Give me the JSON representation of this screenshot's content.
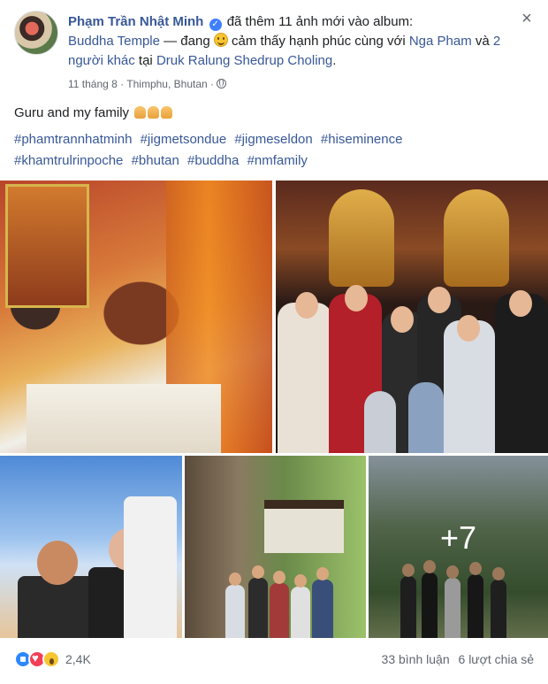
{
  "post": {
    "author": "Phạm Trần Nhật Minh",
    "action": "đã thêm 11 ảnh mới vào album:",
    "album": "Buddha Temple",
    "feeling_prefix": "— đang",
    "feeling": "cảm thấy hạnh phúc cùng với",
    "tagged": "Nga Pham",
    "and_others": "và",
    "others": "2 người khác",
    "at": "tại",
    "place": "Druk Ralung Shedrup Choling",
    "period": ".",
    "date": "11 tháng 8",
    "location": "Thimphu, Bhutan",
    "separator": "·",
    "caption": "Guru and my family",
    "hashtags": [
      "#phamtrannhatminh",
      "#jigmetsondue",
      "#jigmeseldon",
      "#hiseminence",
      "#khamtrulrinpoche",
      "#bhutan",
      "#buddha",
      "#nmfamily"
    ]
  },
  "gallery": {
    "more_count": "+7"
  },
  "footer": {
    "reaction_count": "2,4K",
    "comments": "33 bình luận",
    "shares": "6 lượt chia sẻ"
  },
  "icons": {
    "verified": "verified-badge-icon",
    "feeling": "smile-emoji-icon",
    "privacy": "globe-icon",
    "close": "close-icon",
    "reactions": [
      "like-icon",
      "love-icon",
      "wow-icon"
    ]
  },
  "colors": {
    "link": "#385898",
    "verified": "#4080ff",
    "like": "#2d88ff",
    "love": "#f33e58",
    "wow": "#f7c531"
  }
}
